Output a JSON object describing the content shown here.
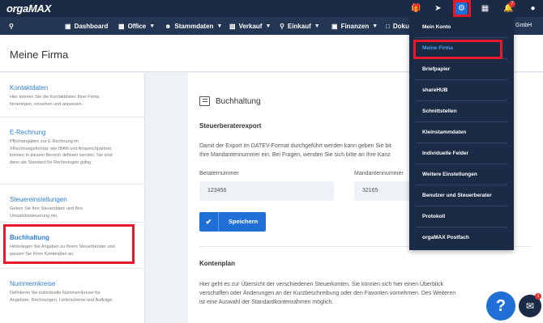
{
  "app": {
    "logo": "orgaMAX"
  },
  "topbar": {
    "icons": [
      "gift-icon",
      "rocket-icon",
      "gear-icon",
      "grid-icon",
      "bell-icon",
      "user-icon"
    ],
    "notification_count": "7"
  },
  "nav": {
    "items": [
      {
        "label": "Dashboard",
        "icon": "dashboard-icon"
      },
      {
        "label": "Office",
        "icon": "briefcase-icon"
      },
      {
        "label": "Stammdaten",
        "icon": "people-icon"
      },
      {
        "label": "Verkauf",
        "icon": "truck-icon"
      },
      {
        "label": "Einkauf",
        "icon": "cart-icon"
      },
      {
        "label": "Finanzen",
        "icon": "bank-icon"
      },
      {
        "label": "Doku",
        "icon": "document-icon"
      }
    ],
    "company_suffix": "GmbH"
  },
  "page": {
    "title": "Meine Firma"
  },
  "left_list": [
    {
      "title": "Kontaktdaten",
      "desc": [
        "Hier können Sie die Kontaktdaten Ihrer Firma",
        "hinterlegen, einsehen und anpassen."
      ]
    },
    {
      "title": "E-Rechnung",
      "desc": [
        "Pflichtangaben zur E-Rechnung im",
        "XRechnungsformat, wie IBAN und Ansprechpartner,",
        "können in diesem Bereich definiert werden. Sie sind",
        "dann als Standard für Rechnungen gültig."
      ]
    },
    {
      "title": "Steuereinstellungen",
      "desc": [
        "Geben Sie Ihre Steuerdaten und Ihre",
        "Umsatzbesteuerung ein."
      ]
    },
    {
      "title": "Buchhaltung",
      "desc": [
        "Hinterlegen Sie Angaben zu Ihrem Steuerberater und",
        "passen Sie Ihren Kontenplan an."
      ]
    },
    {
      "title": "Nummernkreise",
      "desc": [
        "Definieren Sie individuelle Nummernkreise für",
        "Angebote, Rechnungen, Lieferscheine und Aufträge."
      ]
    }
  ],
  "main": {
    "section_title": "Buchhaltung",
    "export_heading": "Steuerberaterexport",
    "export_text": [
      "Damit der Export im DATEV-Format durchgeführt werden kann geben Sie bit",
      "Ihre Mandantennummer ein. Bei Fragen, wenden Sie sich bitte an Ihre Kanz"
    ],
    "berater_label": "Beraternummer",
    "berater_value": "123456",
    "mandant_label": "Mandantennummer",
    "mandant_value": "32165",
    "save_label": "Speichern",
    "kontenplan_heading": "Kontenplan",
    "kontenplan_text": [
      "Hier geht es zur Übersicht der verschiedenen Steuerkonten. Sie können sich hier einen Überblick",
      "verschaffen oder Änderungen an der Kurzbeschreibung oder den Favoriten vornehmen. Des Weiteren",
      "ist eine Auswahl der Standardkontenrahmen möglich."
    ]
  },
  "dropdown": {
    "items": [
      "Mein Konto",
      "Meine Firma",
      "Briefpapier",
      "shareHUB",
      "Schnittstellen",
      "Kleinstammdaten",
      "Individuelle Felder",
      "Weitere Einstellungen",
      "Benutzer und Steuerberater",
      "Protokoll",
      "orgaMAX Postfach"
    ],
    "active_item": "Meine Firma"
  },
  "floating": {
    "help_label": "?",
    "chat_badge": "1"
  },
  "colors": {
    "topbar": "#1b2b45",
    "navbar": "#233755",
    "accent": "#1f6fd6",
    "highlight_box": "#e8192c"
  }
}
